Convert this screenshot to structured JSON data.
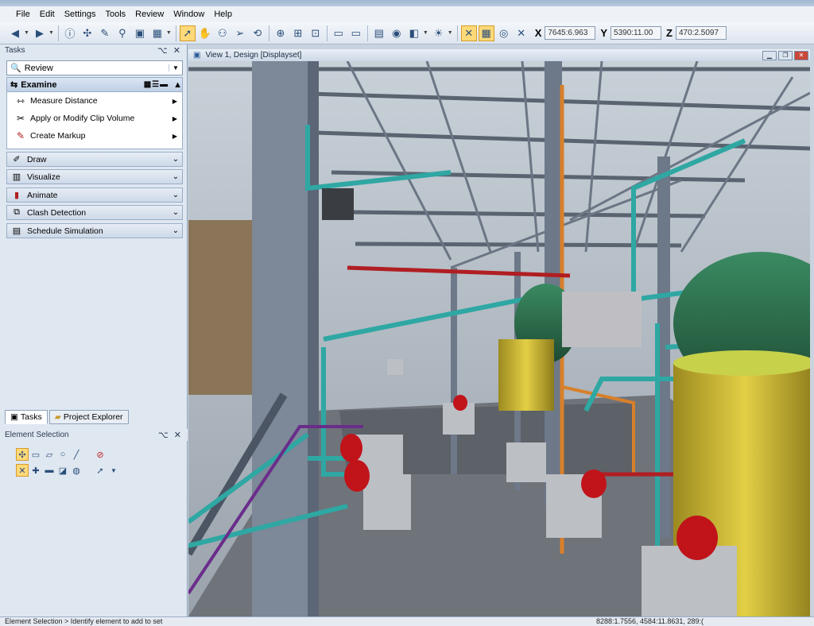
{
  "menu": [
    "File",
    "Edit",
    "Settings",
    "Tools",
    "Review",
    "Window",
    "Help"
  ],
  "coords": {
    "x_label": "X",
    "x_value": "7645:6.963",
    "y_label": "Y",
    "y_value": "5390:11.00",
    "z_label": "Z",
    "z_value": "470:2.5097"
  },
  "tasks": {
    "title": "Tasks",
    "pin": "⌥ ✕",
    "workflow": "Review",
    "examine": {
      "title": "Examine",
      "items": [
        {
          "label": "Measure Distance"
        },
        {
          "label": "Apply or Modify Clip Volume"
        },
        {
          "label": "Create Markup"
        }
      ]
    },
    "groups": [
      {
        "label": "Draw"
      },
      {
        "label": "Visualize"
      },
      {
        "label": "Animate"
      },
      {
        "label": "Clash Detection"
      },
      {
        "label": "Schedule Simulation"
      }
    ]
  },
  "tabs": [
    "Tasks",
    "Project Explorer"
  ],
  "element_selection": {
    "title": "Element Selection"
  },
  "view": {
    "title": "View 1, Design [Displayset]"
  },
  "status": {
    "left": "Element Selection > Identify element to add to set",
    "right": "8288:1.7556, 4584:11.8631, 289:("
  },
  "colors": {
    "steel": "#7f8a99",
    "teal_pipe": "#2fa7a3",
    "red_pipe": "#b01e22",
    "orange_pipe": "#d8802a",
    "tank_yellow": "#d9c33a",
    "motor_green": "#2e6a4a",
    "floor": "#6f737a"
  }
}
